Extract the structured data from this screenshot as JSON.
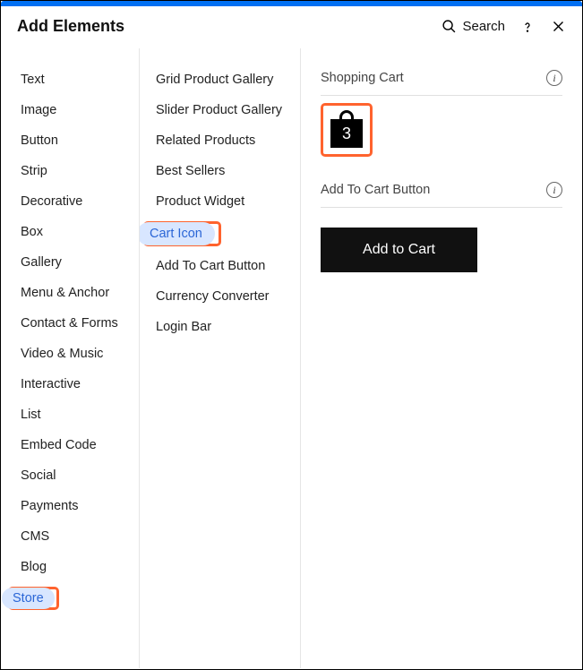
{
  "header": {
    "title": "Add Elements",
    "search_label": "Search"
  },
  "col1": [
    {
      "label": "Text",
      "selected": false
    },
    {
      "label": "Image",
      "selected": false
    },
    {
      "label": "Button",
      "selected": false
    },
    {
      "label": "Strip",
      "selected": false
    },
    {
      "label": "Decorative",
      "selected": false
    },
    {
      "label": "Box",
      "selected": false
    },
    {
      "label": "Gallery",
      "selected": false
    },
    {
      "label": "Menu & Anchor",
      "selected": false
    },
    {
      "label": "Contact & Forms",
      "selected": false
    },
    {
      "label": "Video & Music",
      "selected": false
    },
    {
      "label": "Interactive",
      "selected": false
    },
    {
      "label": "List",
      "selected": false
    },
    {
      "label": "Embed Code",
      "selected": false
    },
    {
      "label": "Social",
      "selected": false
    },
    {
      "label": "Payments",
      "selected": false
    },
    {
      "label": "CMS",
      "selected": false
    },
    {
      "label": "Blog",
      "selected": false
    },
    {
      "label": "Store",
      "selected": true
    }
  ],
  "col2": [
    {
      "label": "Grid Product Gallery",
      "selected": false
    },
    {
      "label": "Slider Product Gallery",
      "selected": false
    },
    {
      "label": "Related Products",
      "selected": false
    },
    {
      "label": "Best Sellers",
      "selected": false
    },
    {
      "label": "Product Widget",
      "selected": false
    },
    {
      "label": "Cart Icon",
      "selected": true
    },
    {
      "label": "Add To Cart Button",
      "selected": false
    },
    {
      "label": "Currency Converter",
      "selected": false
    },
    {
      "label": "Login Bar",
      "selected": false
    }
  ],
  "preview": {
    "section1_title": "Shopping Cart",
    "cart_count": "3",
    "section2_title": "Add To Cart Button",
    "atc_label": "Add to Cart"
  }
}
